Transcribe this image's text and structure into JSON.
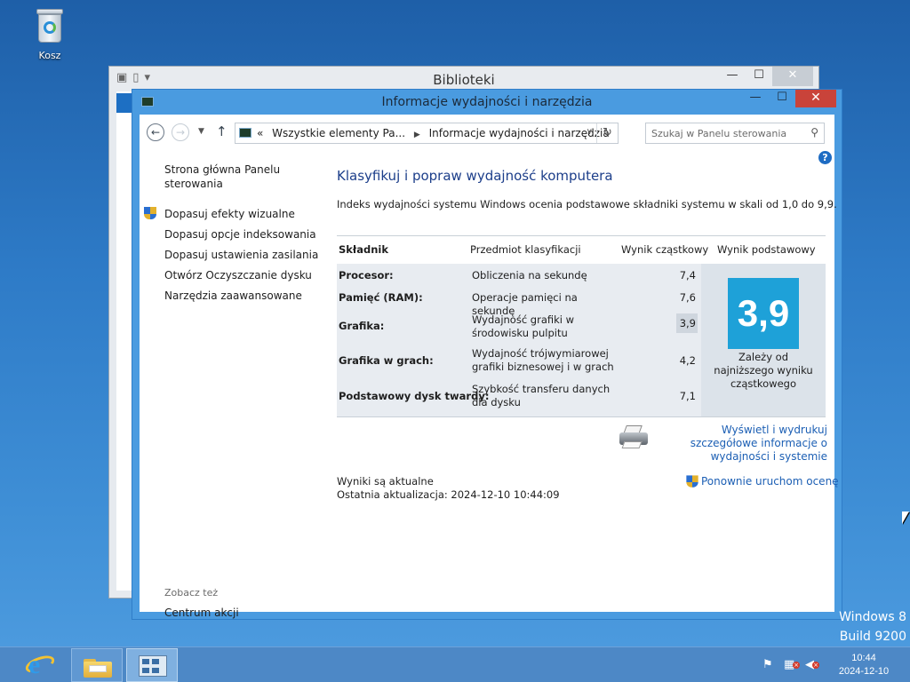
{
  "desktop": {
    "recycle_bin_label": "Kosz"
  },
  "back_window": {
    "title": "Biblioteki"
  },
  "window": {
    "title": "Informacje wydajności i narzędzia",
    "controls": {
      "minimize": "—",
      "maximize": "☐",
      "close": "✕"
    }
  },
  "address_bar": {
    "prefix": "«",
    "crumb1": "Wszystkie elementy Pa...",
    "crumb2": "Informacje wydajności i narzędzia",
    "search_placeholder": "Szukaj w Panelu sterowania"
  },
  "left_pane": {
    "home_link": "Strona główna Panelu sterowania",
    "items": [
      {
        "label": "Dopasuj efekty wizualne",
        "shield": true
      },
      {
        "label": "Dopasuj opcje indeksowania",
        "shield": false
      },
      {
        "label": "Dopasuj ustawienia zasilania",
        "shield": false
      },
      {
        "label": "Otwórz Oczyszczanie dysku",
        "shield": false
      },
      {
        "label": "Narzędzia zaawansowane",
        "shield": false
      }
    ],
    "see_also": "Zobacz też",
    "see_also_items": [
      "Centrum akcji"
    ]
  },
  "main": {
    "heading": "Klasyfikuj i popraw wydajność komputera",
    "description": "Indeks wydajności systemu Windows ocenia podstawowe składniki systemu w skali od 1,0 do 9,9.",
    "table": {
      "headers": [
        "Składnik",
        "Przedmiot klasyfikacji",
        "Wynik cząstkowy",
        "Wynik podstawowy"
      ],
      "rows": [
        {
          "component": "Procesor:",
          "subject": "Obliczenia na sekundę",
          "score": "7,4"
        },
        {
          "component": "Pamięć (RAM):",
          "subject": "Operacje pamięci na sekundę",
          "score": "7,6"
        },
        {
          "component": "Grafika:",
          "subject": "Wydajność grafiki w środowisku pulpitu",
          "score": "3,9"
        },
        {
          "component": "Grafika w grach:",
          "subject": "Wydajność trójwymiarowej grafiki biznesowej i w grach",
          "score": "4,2"
        },
        {
          "component": "Podstawowy dysk twardy:",
          "subject": "Szybkość transferu danych dla dysku",
          "score": "7,1"
        }
      ],
      "base_score": "3,9",
      "base_note": "Zależy od najniższego wyniku cząstkowego",
      "colors": {
        "base_tile": "#1ea1d8",
        "table_bg": "#e8ecf1"
      }
    },
    "print_link": "Wyświetl i wydrukuj szczegółowe informacje o wydajności i systemie",
    "status_line1": "Wyniki są aktualne",
    "status_line2": "Ostatnia aktualizacja: 2024-12-10 10:44:09",
    "rerun_link": "Ponownie uruchom ocenę"
  },
  "watermark": {
    "line1": "Windows 8",
    "line2": "Build 9200"
  },
  "taskbar": {
    "clock_time": "10:44",
    "clock_date": "2024-12-10"
  },
  "colors": {
    "accent": "#1c5fb4",
    "heading": "#1c3e8a",
    "title_bar": "#4a9be0",
    "close_button": "#c9433a"
  }
}
